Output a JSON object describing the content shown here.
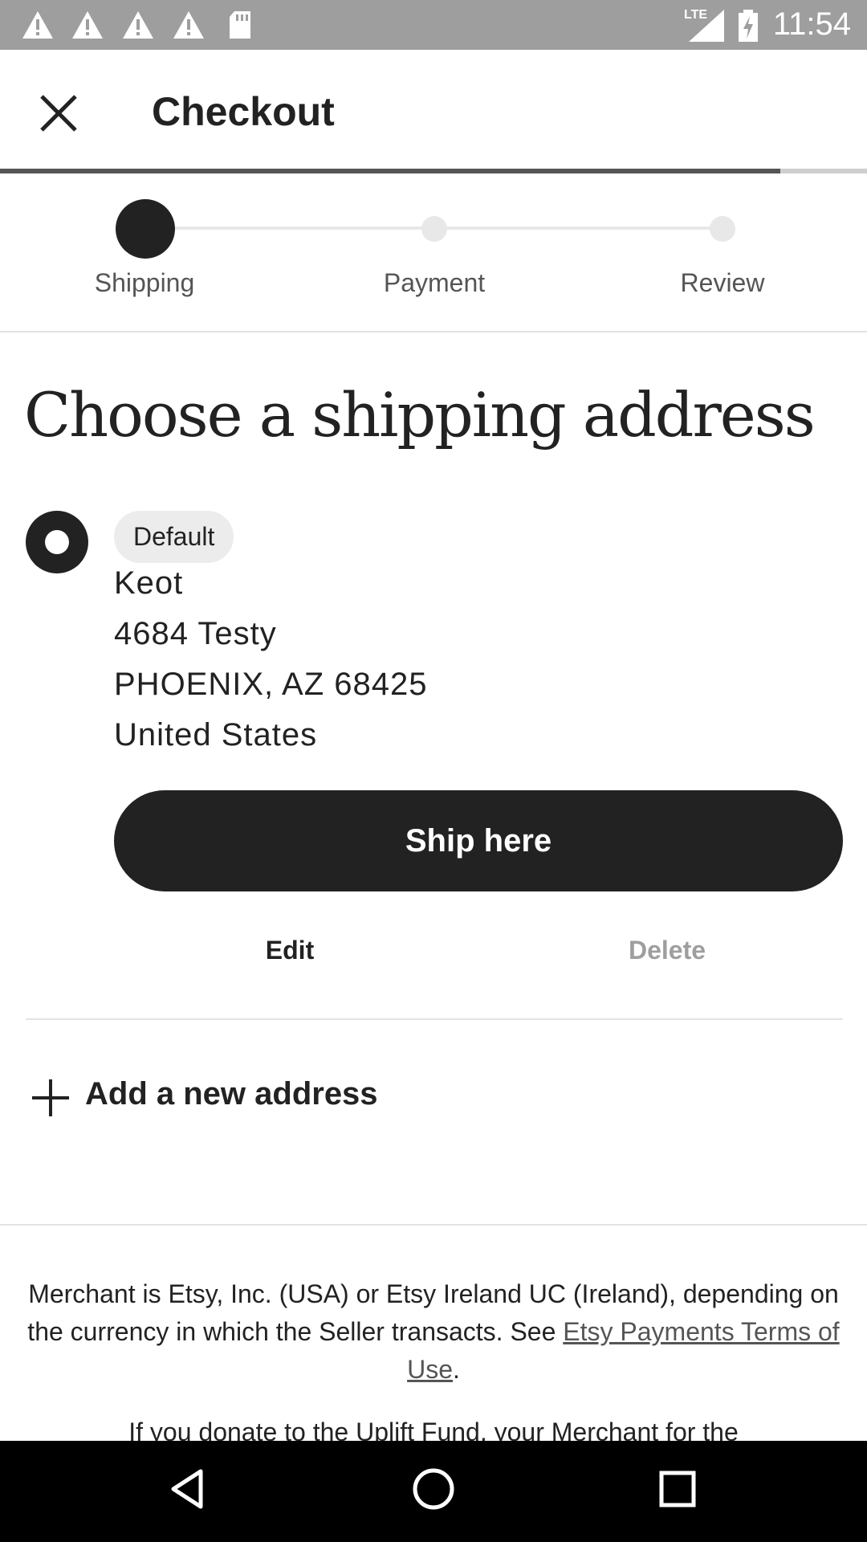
{
  "status_bar": {
    "time": "11:54",
    "network": "LTE",
    "icons": [
      "warning-icon",
      "warning-icon",
      "warning-icon",
      "warning-icon",
      "sd-card-icon",
      "signal-icon",
      "battery-charging-icon"
    ]
  },
  "header": {
    "title": "Checkout",
    "close_icon": "close-icon",
    "progress_percent": 90
  },
  "stepper": {
    "steps": [
      {
        "label": "Shipping",
        "active": true
      },
      {
        "label": "Payment",
        "active": false
      },
      {
        "label": "Review",
        "active": false
      }
    ]
  },
  "main": {
    "heading": "Choose a shipping address",
    "address": {
      "badge": "Default",
      "lines": [
        "Keot",
        "4684 Testy",
        "PHOENIX, AZ 68425",
        "United States"
      ],
      "selected": true
    },
    "ship_button": "Ship here",
    "edit_label": "Edit",
    "delete_label": "Delete",
    "add_address_label": "Add a new address"
  },
  "legal": {
    "merchant_text_1": "Merchant is Etsy, Inc. (USA) or Etsy Ireland UC (Ireland), depending on the currency in which the Seller transacts. See ",
    "terms_link": "Etsy Payments Terms of Use",
    "merchant_text_2": ".",
    "uplift_text": "If you donate to the Uplift Fund, your Merchant for the"
  },
  "colors": {
    "primary": "#222222",
    "muted": "#9e9e9e",
    "status_bar": "#9e9e9e",
    "nav_bar": "#000000"
  },
  "nav_bar": {
    "icons": [
      "back-icon",
      "home-icon",
      "recents-icon"
    ]
  }
}
